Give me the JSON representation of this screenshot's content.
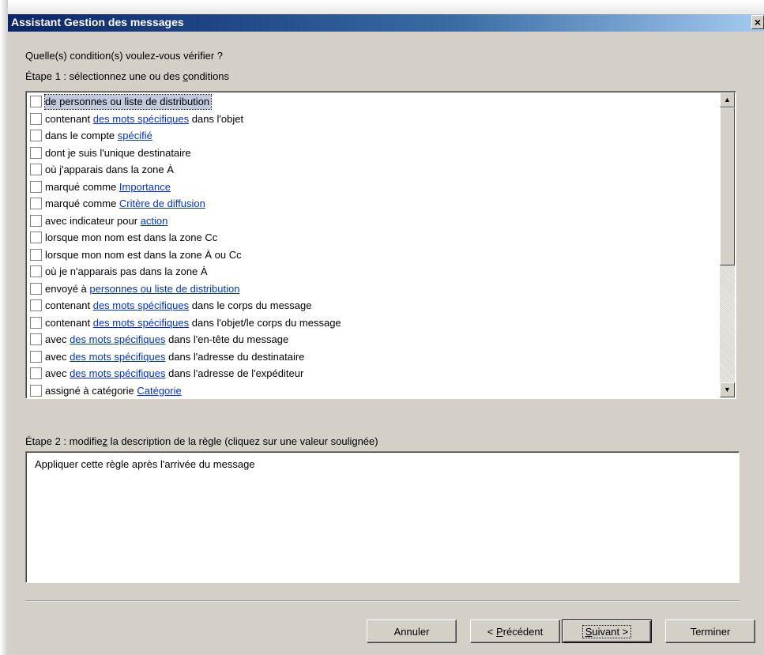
{
  "window": {
    "title": "Assistant Gestion des messages",
    "close_label": "×"
  },
  "prompt": "Quelle(s) condition(s) voulez-vous vérifier ?",
  "step1": {
    "label_before": "Étape 1 : sélectionnez une ou des ",
    "label_accel": "c",
    "label_after": "onditions"
  },
  "conditions": [
    {
      "before": "de personnes ou liste de distribution",
      "link": "",
      "after": "",
      "selected": true
    },
    {
      "before": "contenant ",
      "link": "des mots spécifiques",
      "after": " dans l'objet"
    },
    {
      "before": "dans le compte ",
      "link": "spécifié",
      "after": ""
    },
    {
      "before": "dont je suis l'unique destinataire",
      "link": "",
      "after": ""
    },
    {
      "before": "où j'apparais dans la zone À",
      "link": "",
      "after": ""
    },
    {
      "before": "marqué comme ",
      "link": "Importance",
      "after": ""
    },
    {
      "before": "marqué comme ",
      "link": "Critère de diffusion",
      "after": ""
    },
    {
      "before": "avec indicateur pour ",
      "link": "action ",
      "after": ""
    },
    {
      "before": "lorsque mon nom est dans la zone Cc",
      "link": "",
      "after": ""
    },
    {
      "before": "lorsque mon nom est dans la zone À ou Cc",
      "link": "",
      "after": ""
    },
    {
      "before": "où je n'apparais pas dans la zone À",
      "link": "",
      "after": ""
    },
    {
      "before": "envoyé à ",
      "link": "personnes ou liste de distribution",
      "after": ""
    },
    {
      "before": "contenant ",
      "link": "des mots spécifiques",
      "after": " dans le corps du message"
    },
    {
      "before": "contenant ",
      "link": "des mots spécifiques",
      "after": " dans l'objet/le corps du message"
    },
    {
      "before": "avec ",
      "link": "des mots spécifiques",
      "after": " dans l'en-tête du message"
    },
    {
      "before": "avec ",
      "link": "des mots spécifiques",
      "after": " dans l'adresse du destinataire"
    },
    {
      "before": "avec ",
      "link": "des mots spécifiques",
      "after": " dans l'adresse de l'expéditeur"
    },
    {
      "before": "assigné à catégorie ",
      "link": "Catégorie",
      "after": ""
    }
  ],
  "scrollbar": {
    "up_icon": "arrow-up-icon",
    "down_icon": "arrow-down-icon"
  },
  "step2": {
    "label_before": "Étape 2 : modifie",
    "label_accel": "z",
    "label_after": " la description de la règle (cliquez sur une valeur soulignée)"
  },
  "description": "Appliquer cette règle après l'arrivée du message",
  "buttons": {
    "cancel": "Annuler",
    "prev_before": "< ",
    "prev_accel": "P",
    "prev_after": "récédent",
    "next_accel": "S",
    "next_after": "uivant >",
    "finish": "Terminer"
  },
  "colors": {
    "link": "#0033cc",
    "selection": "#c1c9de",
    "dialog_bg": "#d4d0c8",
    "titlebar": "#0a246a"
  }
}
